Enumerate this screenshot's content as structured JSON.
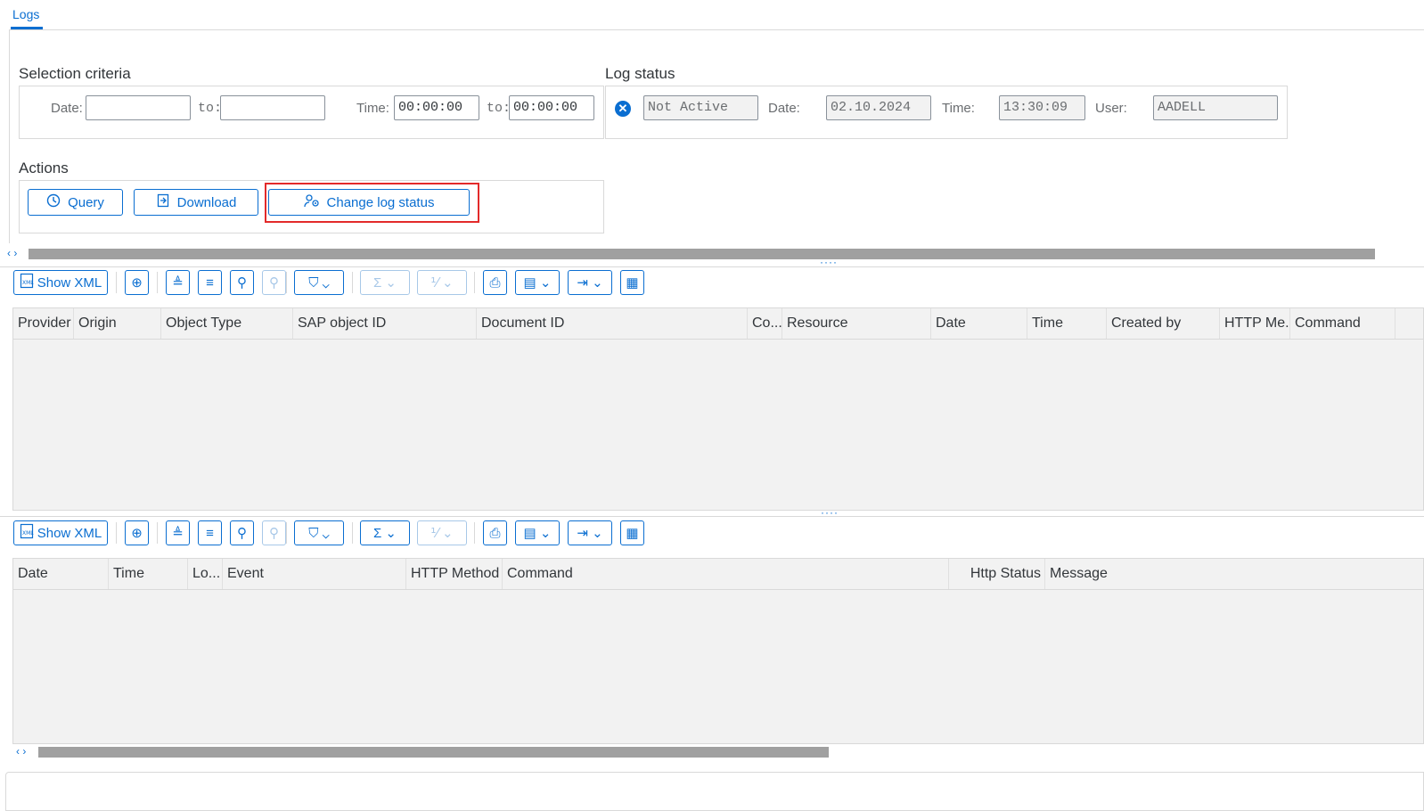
{
  "tabs": {
    "active": "Logs"
  },
  "selection": {
    "title": "Selection criteria",
    "date_label": "Date:",
    "to_label": "to:",
    "date_from": "",
    "date_to": "",
    "time_label": "Time:",
    "time_from": "00:00:00",
    "time_to": "00:00:00"
  },
  "log_status": {
    "title": "Log status",
    "status_value": "Not Active",
    "date_label": "Date:",
    "date_value": "02.10.2024",
    "time_label": "Time:",
    "time_value": "13:30:09",
    "user_label": "User:",
    "user_value": "AADELL"
  },
  "actions": {
    "title": "Actions",
    "query": "Query",
    "download": "Download",
    "change_log_status": "Change log status"
  },
  "grid1": {
    "show_xml": "Show XML",
    "columns": [
      "Provider",
      "Origin",
      "Object Type",
      "SAP object ID",
      "Document ID",
      "Co...",
      "Resource",
      "Date",
      "Time",
      "Created by",
      "HTTP Me...",
      "Command"
    ]
  },
  "grid2": {
    "show_xml": "Show XML",
    "columns": [
      "Date",
      "Time",
      "Lo...",
      "Event",
      "HTTP Method",
      "Command",
      "Http Status",
      "Message"
    ]
  },
  "colors": {
    "accent": "#0a6ed1",
    "highlight": "#e32a2a"
  }
}
